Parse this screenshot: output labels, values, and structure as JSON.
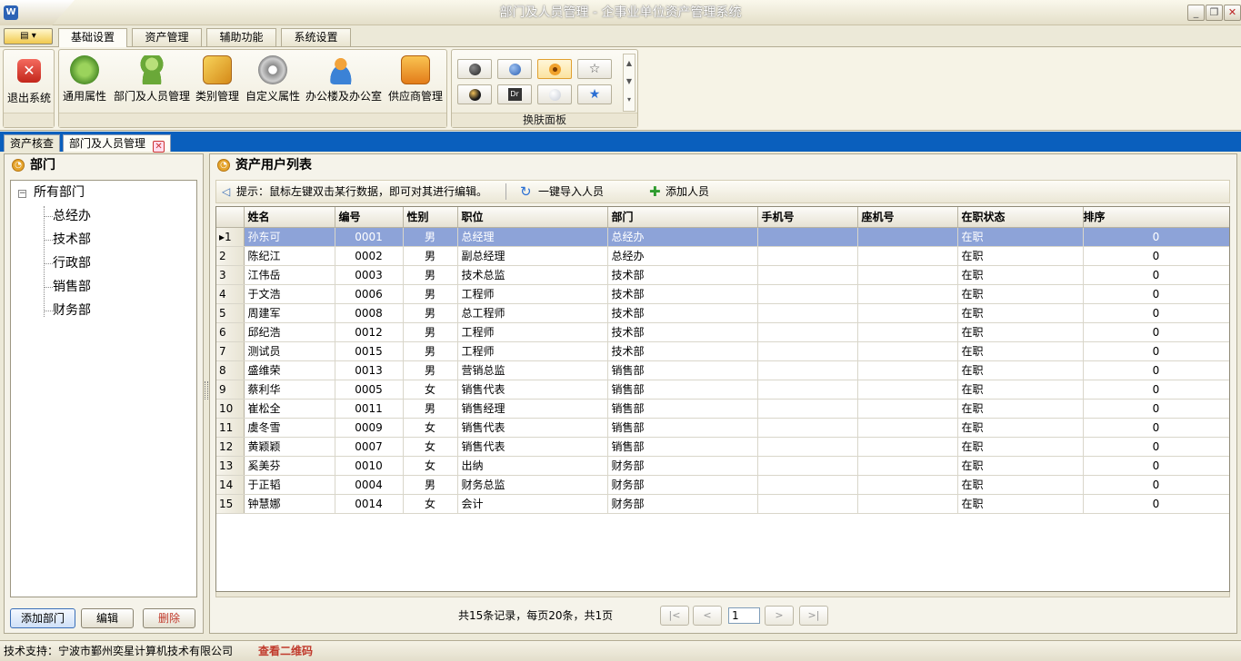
{
  "window": {
    "title": "部门及人员管理 - 企事业单位资产管理系统"
  },
  "ribbon": {
    "tabs": [
      "基础设置",
      "资产管理",
      "辅助功能",
      "系统设置"
    ],
    "buttons": {
      "exit": "退出系统",
      "general": "通用属性",
      "dept_people": "部门及人员管理",
      "category": "类别管理",
      "custom": "自定义属性",
      "office": "办公楼及办公室",
      "supplier": "供应商管理"
    },
    "skin_group_label": "换肤面板"
  },
  "doc_tabs": [
    "资产核查",
    "部门及人员管理"
  ],
  "left": {
    "title": "部门",
    "tree_root": "所有部门",
    "tree_children": [
      "总经办",
      "技术部",
      "行政部",
      "销售部",
      "财务部"
    ],
    "buttons": {
      "add": "添加部门",
      "edit": "编辑",
      "delete": "删除"
    }
  },
  "right": {
    "title": "资产用户列表",
    "hint": "提示：鼠标左键双击某行数据，即可对其进行编辑。",
    "import_btn": "一键导入人员",
    "add_btn": "添加人员",
    "columns": [
      "姓名",
      "编号",
      "性别",
      "职位",
      "部门",
      "手机号",
      "座机号",
      "在职状态",
      "排序"
    ],
    "rows": [
      [
        "孙东可",
        "0001",
        "男",
        "总经理",
        "总经办",
        "",
        "",
        "在职",
        "0"
      ],
      [
        "陈纪江",
        "0002",
        "男",
        "副总经理",
        "总经办",
        "",
        "",
        "在职",
        "0"
      ],
      [
        "江伟岳",
        "0003",
        "男",
        "技术总监",
        "技术部",
        "",
        "",
        "在职",
        "0"
      ],
      [
        "于文浩",
        "0006",
        "男",
        "工程师",
        "技术部",
        "",
        "",
        "在职",
        "0"
      ],
      [
        "周建军",
        "0008",
        "男",
        "总工程师",
        "技术部",
        "",
        "",
        "在职",
        "0"
      ],
      [
        "邱纪浩",
        "0012",
        "男",
        "工程师",
        "技术部",
        "",
        "",
        "在职",
        "0"
      ],
      [
        "测试员",
        "0015",
        "男",
        "工程师",
        "技术部",
        "",
        "",
        "在职",
        "0"
      ],
      [
        "盛维荣",
        "0013",
        "男",
        "营销总监",
        "销售部",
        "",
        "",
        "在职",
        "0"
      ],
      [
        "蔡利华",
        "0005",
        "女",
        "销售代表",
        "销售部",
        "",
        "",
        "在职",
        "0"
      ],
      [
        "崔松全",
        "0011",
        "男",
        "销售经理",
        "销售部",
        "",
        "",
        "在职",
        "0"
      ],
      [
        "虞冬雪",
        "0009",
        "女",
        "销售代表",
        "销售部",
        "",
        "",
        "在职",
        "0"
      ],
      [
        "黄颖颖",
        "0007",
        "女",
        "销售代表",
        "销售部",
        "",
        "",
        "在职",
        "0"
      ],
      [
        "奚美芬",
        "0010",
        "女",
        "出纳",
        "财务部",
        "",
        "",
        "在职",
        "0"
      ],
      [
        "于正韬",
        "0004",
        "男",
        "财务总监",
        "财务部",
        "",
        "",
        "在职",
        "0"
      ],
      [
        "钟慧娜",
        "0014",
        "女",
        "会计",
        "财务部",
        "",
        "",
        "在职",
        "0"
      ]
    ],
    "pager_text": "共15条记录，每页20条，共1页",
    "page_value": "1"
  },
  "status": {
    "support": "技术支持：宁波市鄞州奕星计算机技术有限公司",
    "qrcode": "查看二维码"
  },
  "colors": {
    "selection": "#8da3d8",
    "doc_strip": "#0a5fbd",
    "qrcode_link": "#c0392b"
  }
}
